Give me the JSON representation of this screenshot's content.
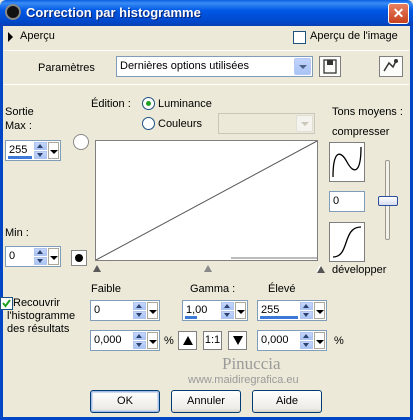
{
  "window": {
    "title": "Correction par histogramme",
    "close_icon": "close-icon"
  },
  "preview": {
    "label": "Aperçu",
    "image_preview_label": "Aperçu de l'image",
    "image_preview_checked": false
  },
  "params": {
    "label": "Paramètres",
    "selected": "Dernières options utilisées"
  },
  "edition": {
    "label": "Édition :",
    "options": [
      "Luminance",
      "Couleurs"
    ],
    "selected": "Luminance"
  },
  "output": {
    "label_sortie": "Sortie",
    "label_max": "Max :",
    "max_value": "255",
    "label_min": "Min :",
    "min_value": "0"
  },
  "midtones": {
    "label": "Tons moyens :",
    "compress": "compresser",
    "value": "0",
    "expand": "développer"
  },
  "controls": {
    "faible_label": "Faible",
    "faible_value": "0",
    "faible_pct": "0,000",
    "gamma_label": "Gamma :",
    "gamma_value": "1,00",
    "ratio_label": "1:1",
    "eleve_label": "Élevé",
    "eleve_value": "255",
    "eleve_pct": "0,000",
    "percent": "%"
  },
  "recover": {
    "label": "Recouvrir l'histogramme des résultats",
    "line1": "Recouvrir",
    "line2": "l'histogramme",
    "line3": "des résultats",
    "checked": true
  },
  "watermark": {
    "name": "Pinuccia",
    "site": "www.maidiregrafica.eu"
  },
  "buttons": {
    "ok": "OK",
    "cancel": "Annuler",
    "help": "Aide"
  },
  "colors": {
    "titlebar": "#0054e3",
    "face": "#ece9d8",
    "accent": "#3c78d8"
  }
}
